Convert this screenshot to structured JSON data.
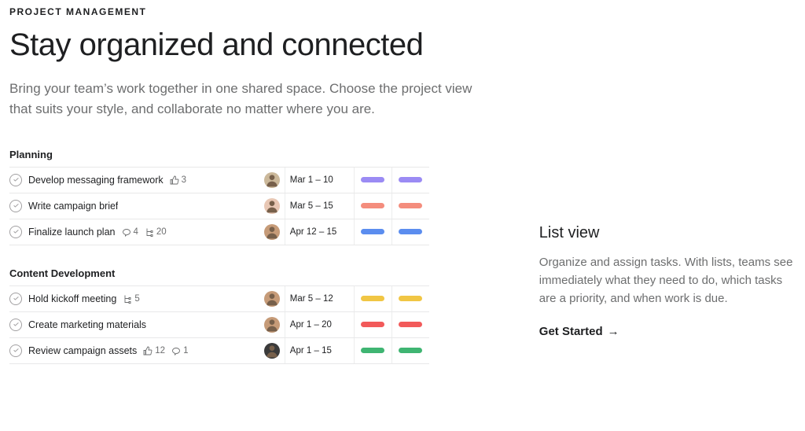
{
  "eyebrow": "PROJECT MANAGEMENT",
  "headline": "Stay organized and connected",
  "subcopy": "Bring your team’s work together in one shared space. Choose the project view that suits your style, and collaborate no matter where you are.",
  "sections": [
    {
      "title": "Planning",
      "tasks": [
        {
          "name": "Develop messaging framework",
          "likes": "3",
          "comments": "",
          "subtasks": "",
          "avatar_bg": "#cbb89a",
          "date": "Mar 1 – 10",
          "pill_color": "#9b8bf4"
        },
        {
          "name": "Write campaign brief",
          "likes": "",
          "comments": "",
          "subtasks": "",
          "avatar_bg": "#e8c7b4",
          "date": "Mar 5 – 15",
          "pill_color": "#f48d7d"
        },
        {
          "name": "Finalize launch plan",
          "likes": "",
          "comments": "4",
          "subtasks": "20",
          "avatar_bg": "#c69b78",
          "date": "Apr 12 – 15",
          "pill_color": "#5b8def"
        }
      ]
    },
    {
      "title": "Content Development",
      "tasks": [
        {
          "name": "Hold kickoff meeting",
          "likes": "",
          "comments": "",
          "subtasks": "5",
          "avatar_bg": "#c69b78",
          "date": "Mar 5 – 12",
          "pill_color": "#f1c644"
        },
        {
          "name": "Create marketing materials",
          "likes": "",
          "comments": "",
          "subtasks": "",
          "avatar_bg": "#c69b78",
          "date": "Apr 1 – 20",
          "pill_color": "#f25a5a"
        },
        {
          "name": "Review campaign assets",
          "likes": "12",
          "comments": "1",
          "subtasks": "",
          "avatar_bg": "#3a3a3a",
          "date": "Apr 1 – 15",
          "pill_color": "#3fb572"
        }
      ]
    }
  ],
  "side": {
    "title": "List view",
    "body": "Organize and assign tasks. With lists, teams see immediately what they need to do, which tasks are a priority, and when work is due.",
    "cta": "Get Started",
    "cta_arrow": "→"
  }
}
